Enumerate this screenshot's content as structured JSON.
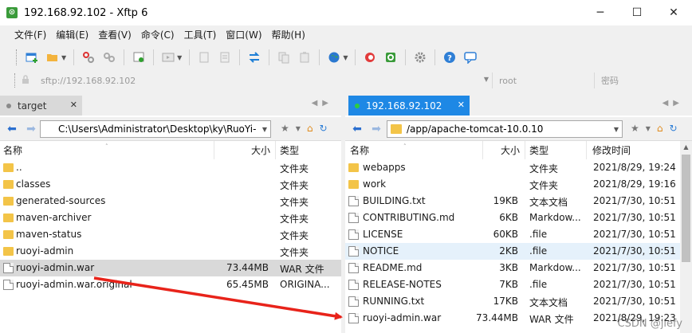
{
  "window": {
    "title": "192.168.92.102 - Xftp 6",
    "app_icon_glyph": "⊙",
    "minimize": "─",
    "maximize": "☐",
    "close": "✕"
  },
  "menu": [
    "文件(F)",
    "编辑(E)",
    "查看(V)",
    "命令(C)",
    "工具(T)",
    "窗口(W)",
    "帮助(H)"
  ],
  "toolbar": {
    "icons": [
      "new-session-icon",
      "open-folder-icon",
      "disconnect-icon",
      "reconnect-icon",
      "new-window-icon",
      "transfer-window-icon",
      "properties-icon",
      "refresh-icon",
      "sync-icon",
      "copy-icon",
      "paste-icon",
      "globe-icon",
      "xshell-icon",
      "xftp-icon",
      "gear-icon",
      "help-icon",
      "chat-icon"
    ]
  },
  "address": {
    "url": "sftp://192.168.92.102",
    "user_placeholder": "root",
    "password_placeholder": "密码"
  },
  "left": {
    "tab_label": "target",
    "tab_dot_color": "#b0b0b0",
    "path": "C:\\Users\\Administrator\\Desktop\\ky\\RuoYi-",
    "columns": [
      "名称",
      "大小",
      "类型"
    ],
    "files": [
      {
        "name": "..",
        "size": "",
        "type": "文件夹",
        "kind": "folder"
      },
      {
        "name": "classes",
        "size": "",
        "type": "文件夹",
        "kind": "folder"
      },
      {
        "name": "generated-sources",
        "size": "",
        "type": "文件夹",
        "kind": "folder"
      },
      {
        "name": "maven-archiver",
        "size": "",
        "type": "文件夹",
        "kind": "folder"
      },
      {
        "name": "maven-status",
        "size": "",
        "type": "文件夹",
        "kind": "folder"
      },
      {
        "name": "ruoyi-admin",
        "size": "",
        "type": "文件夹",
        "kind": "folder"
      },
      {
        "name": "ruoyi-admin.war",
        "size": "73.44MB",
        "type": "WAR 文件",
        "kind": "file",
        "state": "sel"
      },
      {
        "name": "ruoyi-admin.war.original",
        "size": "65.45MB",
        "type": "ORIGINA...",
        "kind": "file"
      }
    ]
  },
  "right": {
    "tab_label": "192.168.92.102",
    "tab_dot_color": "#2ecc40",
    "path": "/app/apache-tomcat-10.0.10",
    "columns": [
      "名称",
      "大小",
      "类型",
      "修改时间"
    ],
    "files": [
      {
        "name": "webapps",
        "size": "",
        "type": "文件夹",
        "modified": "2021/8/29, 19:24",
        "kind": "folder"
      },
      {
        "name": "work",
        "size": "",
        "type": "文件夹",
        "modified": "2021/8/29, 19:16",
        "kind": "folder"
      },
      {
        "name": "BUILDING.txt",
        "size": "19KB",
        "type": "文本文档",
        "modified": "2021/7/30, 10:51",
        "kind": "file"
      },
      {
        "name": "CONTRIBUTING.md",
        "size": "6KB",
        "type": "Markdow...",
        "modified": "2021/7/30, 10:51",
        "kind": "file"
      },
      {
        "name": "LICENSE",
        "size": "60KB",
        "type": ".file",
        "modified": "2021/7/30, 10:51",
        "kind": "file"
      },
      {
        "name": "NOTICE",
        "size": "2KB",
        "type": ".file",
        "modified": "2021/7/30, 10:51",
        "kind": "file",
        "state": "hover"
      },
      {
        "name": "README.md",
        "size": "3KB",
        "type": "Markdow...",
        "modified": "2021/7/30, 10:51",
        "kind": "file"
      },
      {
        "name": "RELEASE-NOTES",
        "size": "7KB",
        "type": ".file",
        "modified": "2021/7/30, 10:51",
        "kind": "file"
      },
      {
        "name": "RUNNING.txt",
        "size": "17KB",
        "type": "文本文档",
        "modified": "2021/7/30, 10:51",
        "kind": "file"
      },
      {
        "name": "ruoyi-admin.war",
        "size": "73.44MB",
        "type": "WAR 文件",
        "modified": "2021/8/29, 19:23",
        "kind": "file"
      }
    ]
  },
  "annotation": {
    "arrow_color": "#e8231a",
    "watermark": "CSDN @jiefy"
  }
}
